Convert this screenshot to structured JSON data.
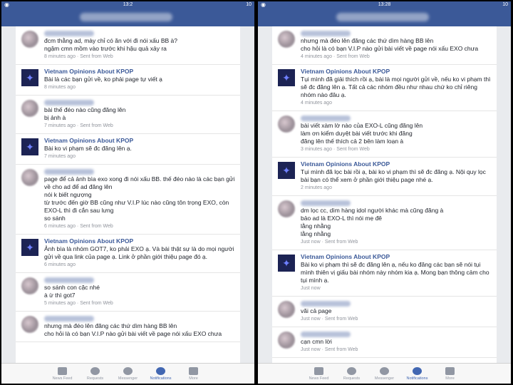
{
  "left": {
    "status_time": "13:2",
    "status_battery": "10",
    "comments": [
      {
        "kind": "user",
        "text": "đcm thằng ad, mày chỉ có ăn với đi nói xấu BB à?\nngậm cmn mồm vào trước khi hậu quả xảy ra",
        "meta": "8 minutes ago · Sent from Web"
      },
      {
        "kind": "page",
        "name": "Vietnam Opinions About KPOP",
        "text": "Bài là các bạn gửi về, ko phải page tự viết ạ",
        "meta": "8 minutes ago"
      },
      {
        "kind": "user",
        "text": "bài thế đéo nào cũng đăng lên\nbị ảnh à",
        "meta": "7 minutes ago · Sent from Web"
      },
      {
        "kind": "page",
        "name": "Vietnam Opinions About KPOP",
        "text": "Bài ko vi phạm sẽ đc đăng lên ạ.",
        "meta": "7 minutes ago"
      },
      {
        "kind": "user",
        "text": "page để cả ảnh bìa exo xong đi nói xấu BB. thế đéo nào là các bạn gửi về cho ad để ad đăng lên\nnói k biết ngượng\ntừ trước đến giờ BB cũng như V.I.P lúc nào cũng tôn trọng EXO, còn EXO-L thì đi cắn sau lưng\nso sánh",
        "meta": "6 minutes ago · Sent from Web"
      },
      {
        "kind": "page",
        "name": "Vietnam Opinions About KPOP",
        "text": "Ảnh bìa là nhóm GOT7, ko phải EXO ạ. Và bài thật sự là do mọi người gửi về qua link của page ạ. Link ở phần giới thiệu page đó ạ.",
        "meta": "6 minutes ago"
      },
      {
        "kind": "user",
        "text": "so sánh con cặc nhé\nà ừ thì got7",
        "meta": "5 minutes ago · Sent from Web"
      },
      {
        "kind": "user",
        "text": "nhưng mà đéo lên đăng các thứ dìm hàng BB lên\ncho hỏi là có bạn V.I.P nào gửi bài viết về page nói xấu EXO chưa",
        "meta": ""
      }
    ],
    "tabs": [
      "News Feed",
      "Requests",
      "Messenger",
      "Notifications",
      "More"
    ]
  },
  "right": {
    "status_time": "13:28",
    "status_battery": "10",
    "comments": [
      {
        "kind": "user",
        "text": "nhưng mà đéo lên đăng các thứ dìm hàng BB lên\ncho hỏi là có bạn V.I.P nào gửi bài viết về page nói xấu EXO chưa",
        "meta": "4 minutes ago · Sent from Web"
      },
      {
        "kind": "page",
        "name": "Vietnam Opinions About KPOP",
        "text": "Tụi mình đã giải thích rồi ạ, bài là mọi người gửi về, nếu ko vi phạm thì sẽ đc đăng lên ạ. Tất cả các nhóm đều như nhau chứ ko chỉ riêng nhóm nào đâu ạ.",
        "meta": "4 minutes ago"
      },
      {
        "kind": "user",
        "text": "bài viết xàm lờ nào của EXO-L cũng đăng lên\nlàm ơn kiểm duyệt bài viết trước khi đăng\nđăng lên thế thích cả 2 bên làm loạn à",
        "meta": "3 minutes ago · Sent from Web"
      },
      {
        "kind": "page",
        "name": "Vietnam Opinions About KPOP",
        "text": "Tụi mình đã lọc bài rồi ạ, bài ko vi phạm thì sẽ đc đăng ạ. Nội quy lọc bài bạn có thể xem ở phần giới thiệu page nhé ạ.",
        "meta": "2 minutes ago"
      },
      {
        "kind": "user",
        "text": "dm lọc cc, dìm hàng idol người khác mà cũng đăng à\nbảo ad là EXO-L thì nói mẹ đê\nlằng nhằng\nlằng nhằng",
        "meta": "Just now · Sent from Web"
      },
      {
        "kind": "page",
        "name": "Vietnam Opinions About KPOP",
        "text": "Bài ko vi phạm thì sẽ đc đăng lên ạ, nếu ko đăng các bạn sẽ nói tụi mình thiên vị giấu bài nhóm này nhóm kia ạ. Mong bạn thông cảm cho tụi mình ạ.",
        "meta": "Just now"
      },
      {
        "kind": "user",
        "text": "vãi cả page",
        "meta": "Just now · Sent from Web"
      },
      {
        "kind": "user",
        "text": "cạn cmn lời",
        "meta": "Just now · Sent from Web"
      }
    ],
    "tabs": [
      "News Feed",
      "Requests",
      "Messenger",
      "Notifications",
      "More"
    ]
  }
}
